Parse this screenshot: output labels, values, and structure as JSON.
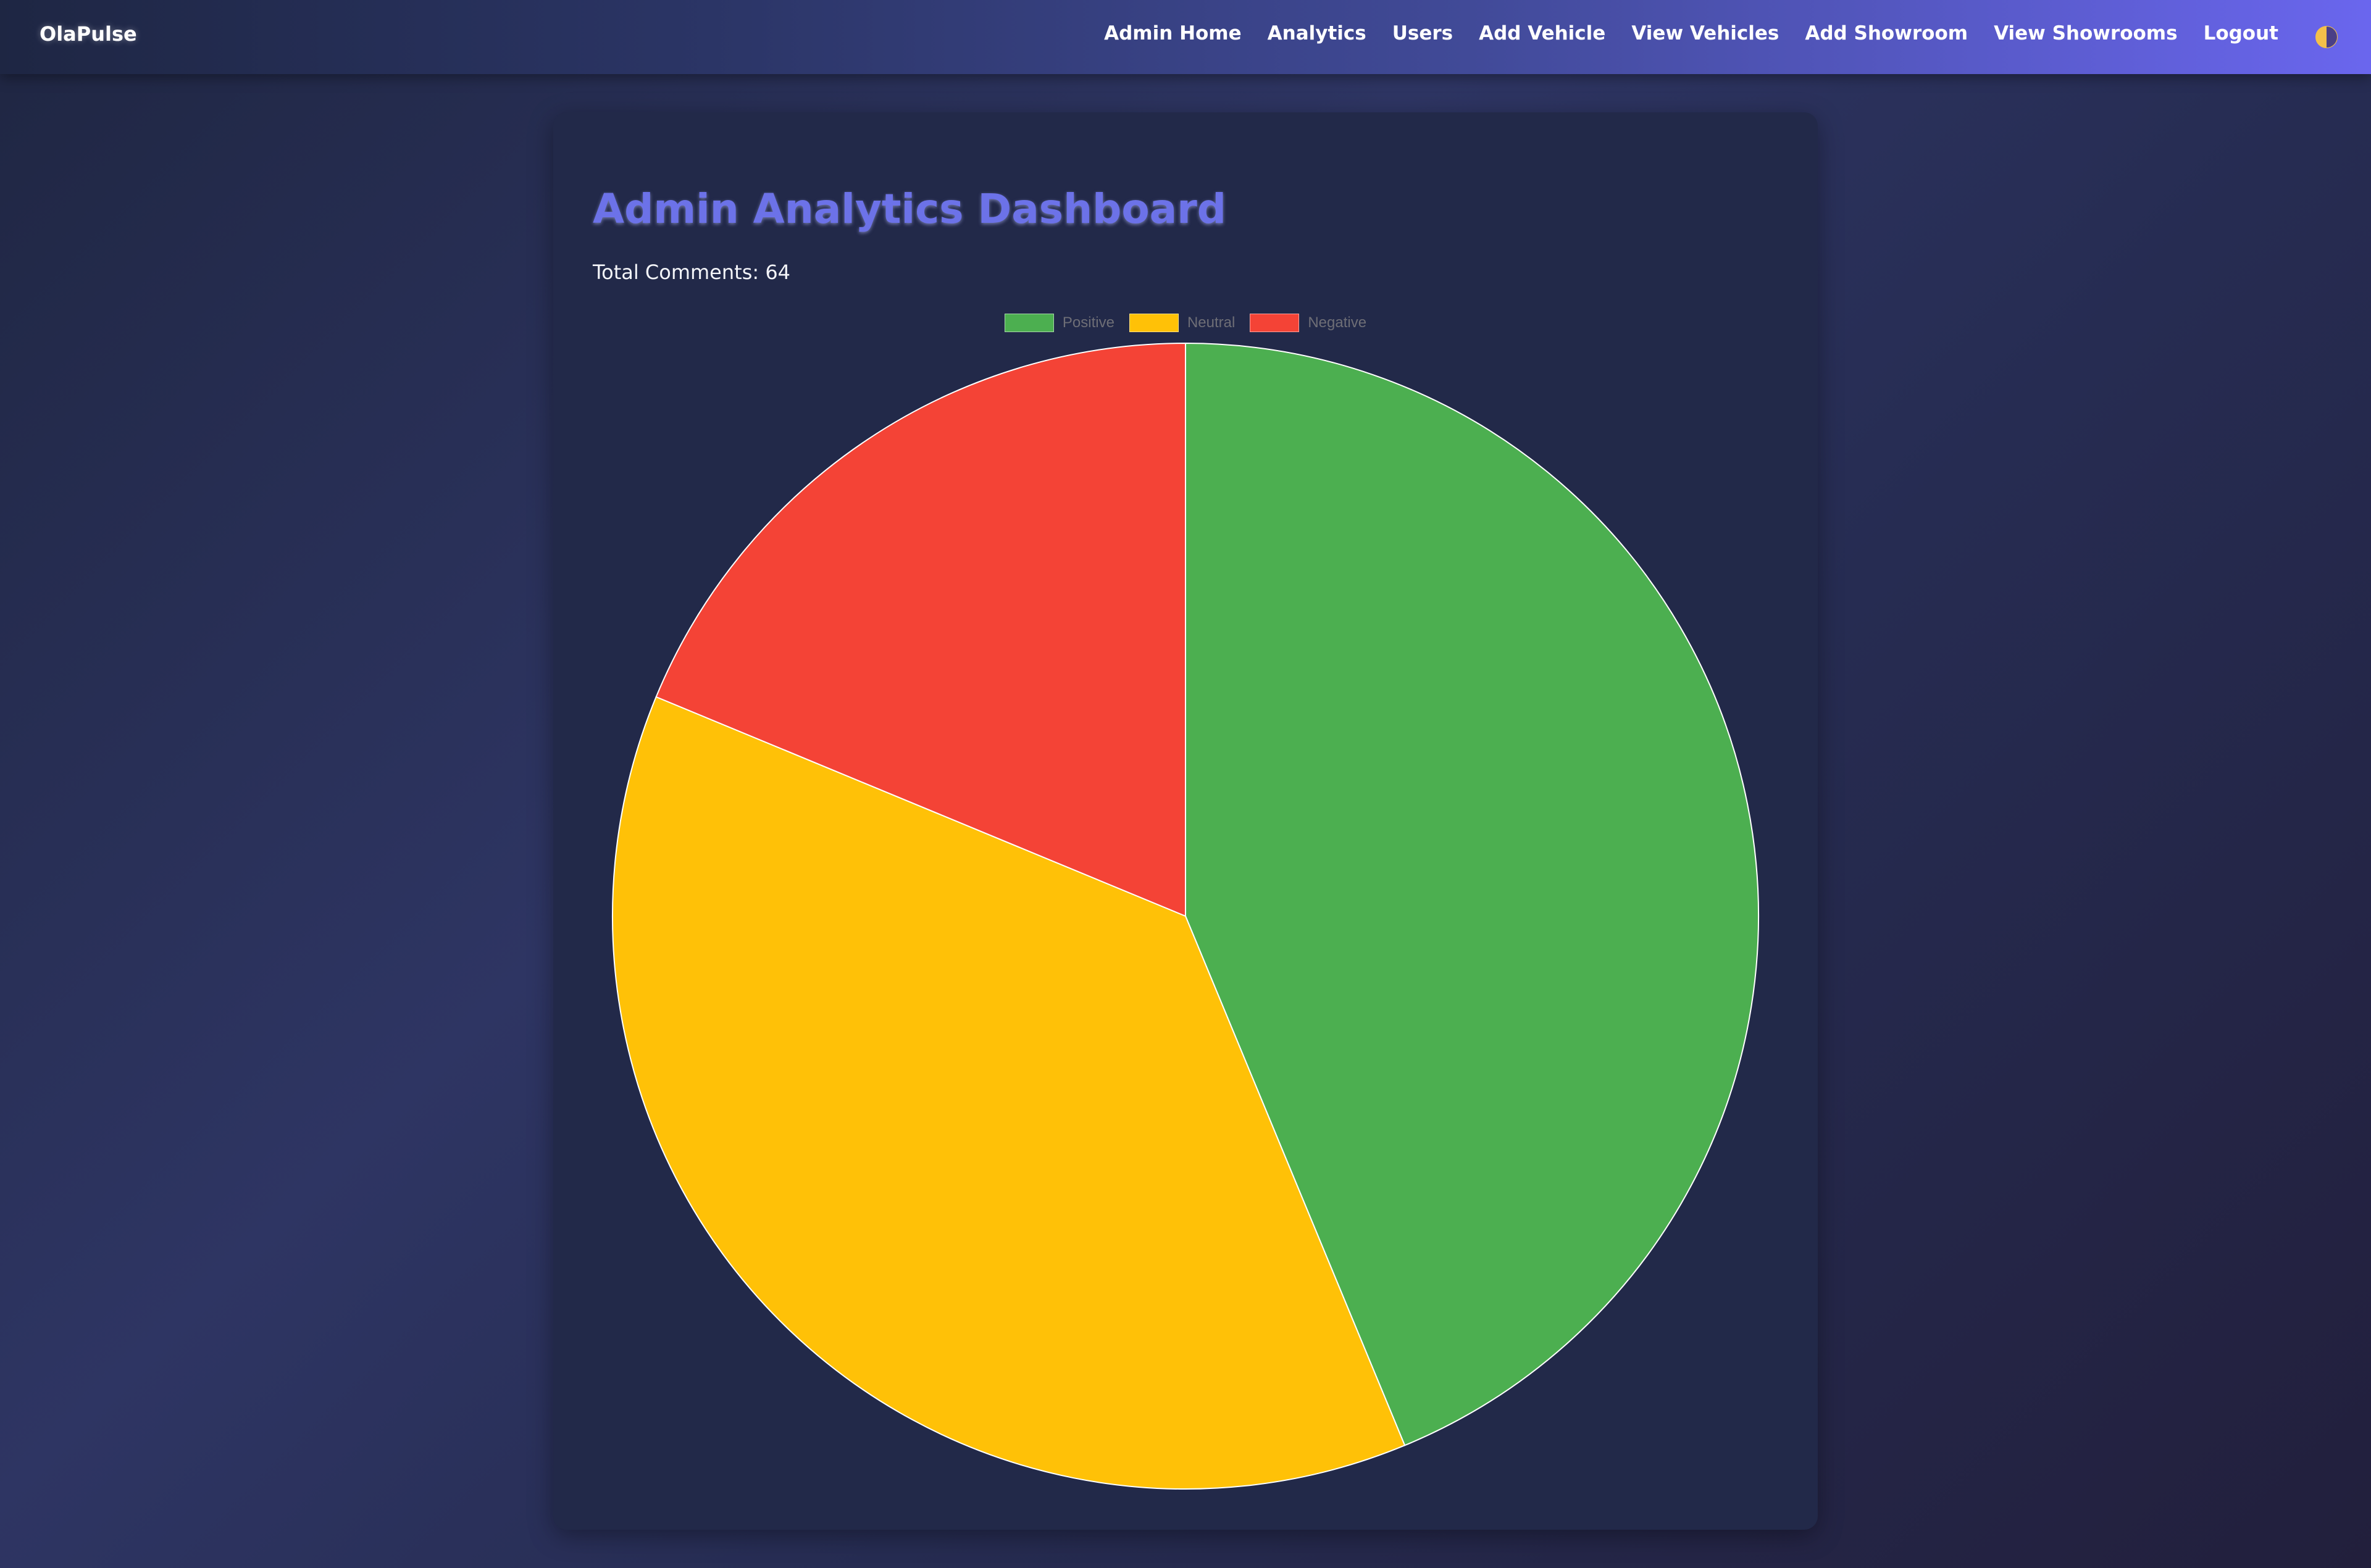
{
  "navbar": {
    "brand": "OlaPulse",
    "links": [
      "Admin Home",
      "Analytics",
      "Users",
      "Add Vehicle",
      "View Vehicles",
      "Add Showroom",
      "View Showrooms",
      "Logout"
    ],
    "theme_icon": "half-moon-icon"
  },
  "main": {
    "title": "Admin Analytics Dashboard",
    "total_comments_label": "Total Comments: 64"
  },
  "colors": {
    "accent": "#6c72e8",
    "positive": "#4caf50",
    "neutral": "#ffc107",
    "negative": "#f44336"
  },
  "chart_data": {
    "type": "pie",
    "categories": [
      "Positive",
      "Neutral",
      "Negative"
    ],
    "values": [
      28,
      24,
      12
    ],
    "colors": [
      "#4caf50",
      "#ffc107",
      "#f44336"
    ],
    "legend": "top-center"
  }
}
